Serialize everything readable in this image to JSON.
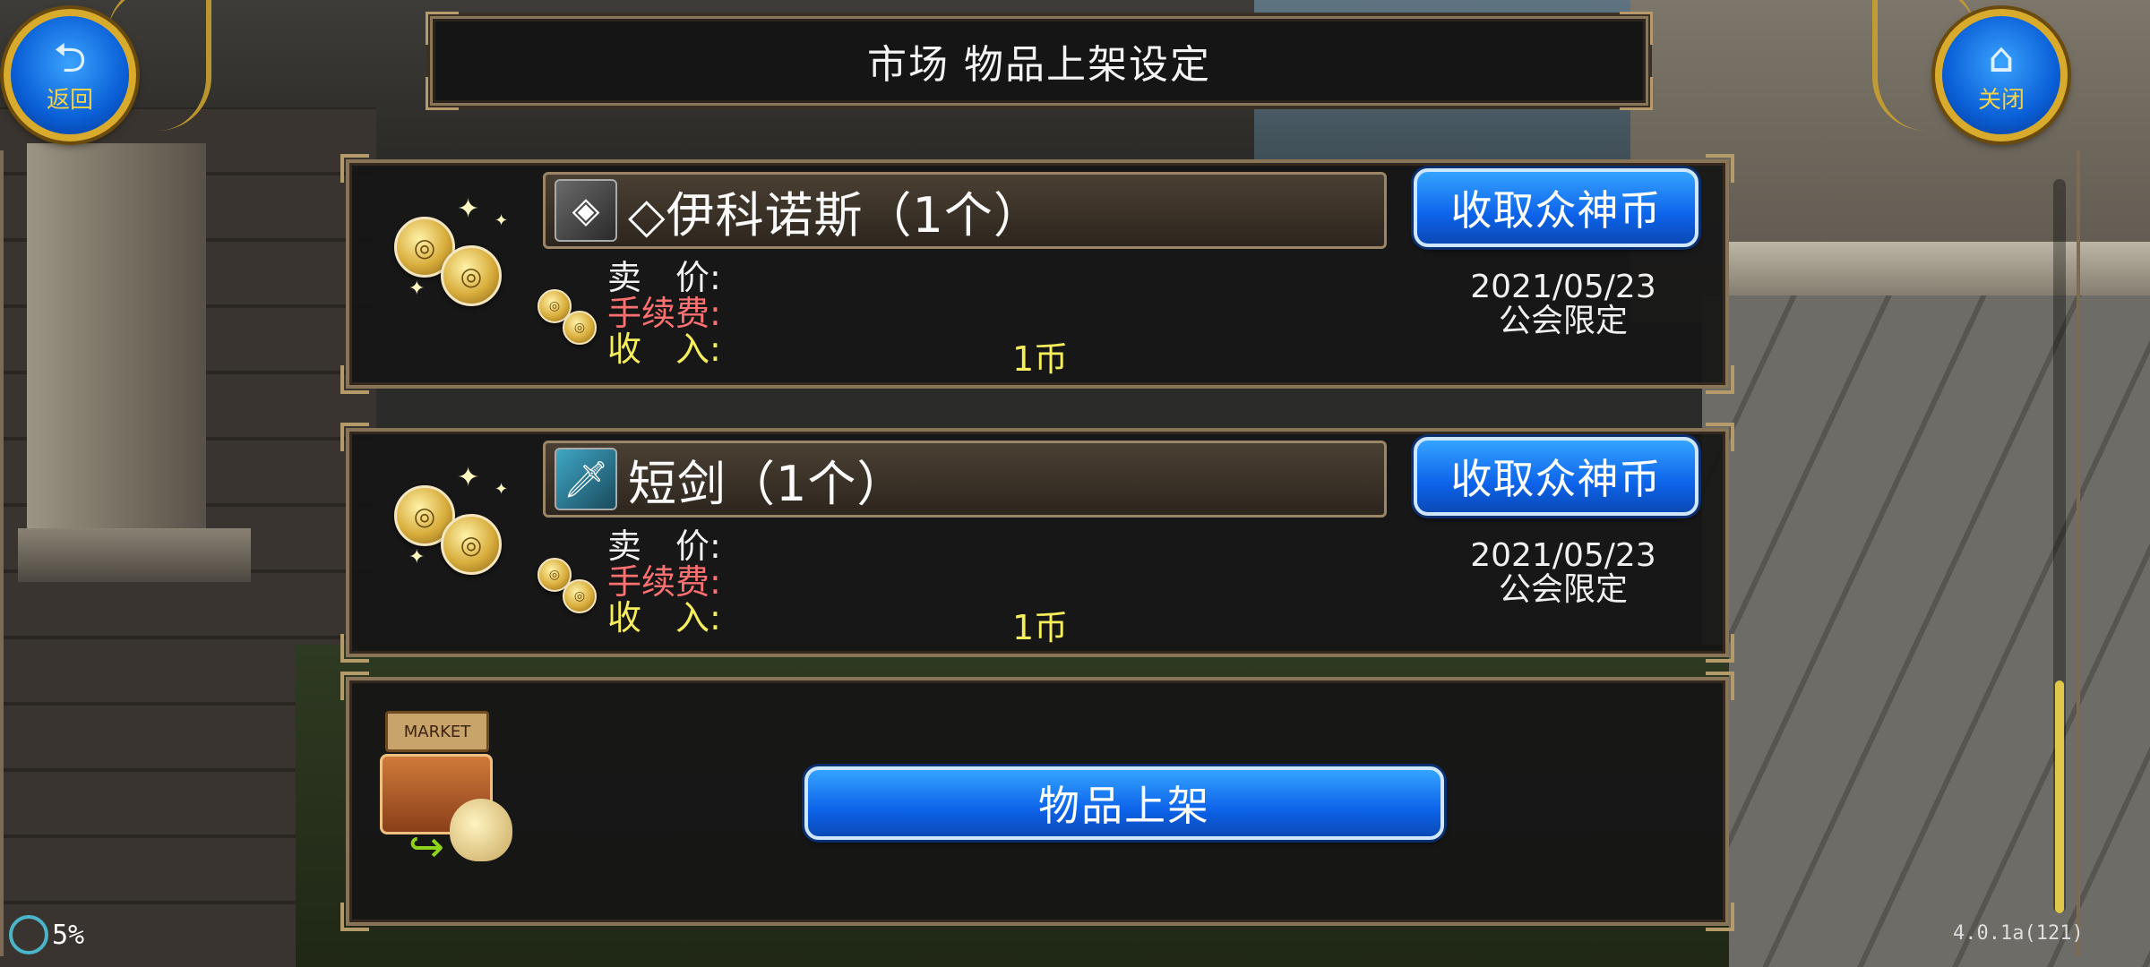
{
  "header": {
    "title": "市场 物品上架设定",
    "back_label": "返回",
    "close_label": "关闭"
  },
  "listings": [
    {
      "item_name": "◇伊科诺斯（1个）",
      "collect_label": "收取众神币",
      "price_label": "卖　价:",
      "fee_label": "手续费:",
      "income_label": "收　入:",
      "income_value": "1币",
      "date": "2021/05/23",
      "restriction": "公会限定"
    },
    {
      "item_name": "短剑（1个）",
      "collect_label": "收取众神币",
      "price_label": "卖　价:",
      "fee_label": "手续费:",
      "income_label": "收　入:",
      "income_value": "1币",
      "date": "2021/05/23",
      "restriction": "公会限定"
    }
  ],
  "market": {
    "sign_text": "MARKET",
    "list_item_label": "物品上架"
  },
  "status": {
    "progress": "5%",
    "version": "4.0.1a(121)"
  },
  "colors": {
    "button_blue": "#0d63ea",
    "fee_red": "#ff7070",
    "income_yellow": "#f6ee5a",
    "frame_bronze": "#8a7458"
  }
}
